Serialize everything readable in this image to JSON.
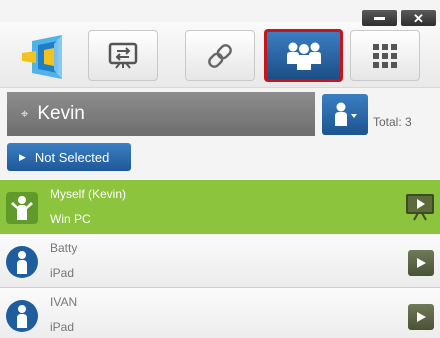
{
  "window": {
    "minimize_icon": "minimize-icon",
    "close_label": "✕"
  },
  "toolbar": {
    "buttons": [
      {
        "name": "logo",
        "icon": "app-logo"
      },
      {
        "name": "screen-share",
        "icon": "screen-arrows-icon"
      },
      {
        "name": "link",
        "icon": "link-icon"
      },
      {
        "name": "users",
        "icon": "users-group-icon",
        "selected": true
      },
      {
        "name": "grid",
        "icon": "grid-icon"
      }
    ],
    "selected_highlight_color": "#c4161c"
  },
  "user": {
    "name": "Kevin",
    "total_label": "Total: 3"
  },
  "filter": {
    "label": "Not Selected"
  },
  "participants": [
    {
      "name": "Myself (Kevin)",
      "device": "Win PC",
      "highlighted": true,
      "action_icon": "presentation-icon"
    },
    {
      "name": "Batty",
      "device": "iPad",
      "highlighted": false,
      "action_icon": "play-icon"
    },
    {
      "name": "IVAN",
      "device": "iPad",
      "highlighted": false,
      "action_icon": "play-icon"
    }
  ],
  "colors": {
    "accent_blue": "#2a6aaa",
    "me_green": "#8cc43e",
    "play_olive": "#5b6444"
  }
}
